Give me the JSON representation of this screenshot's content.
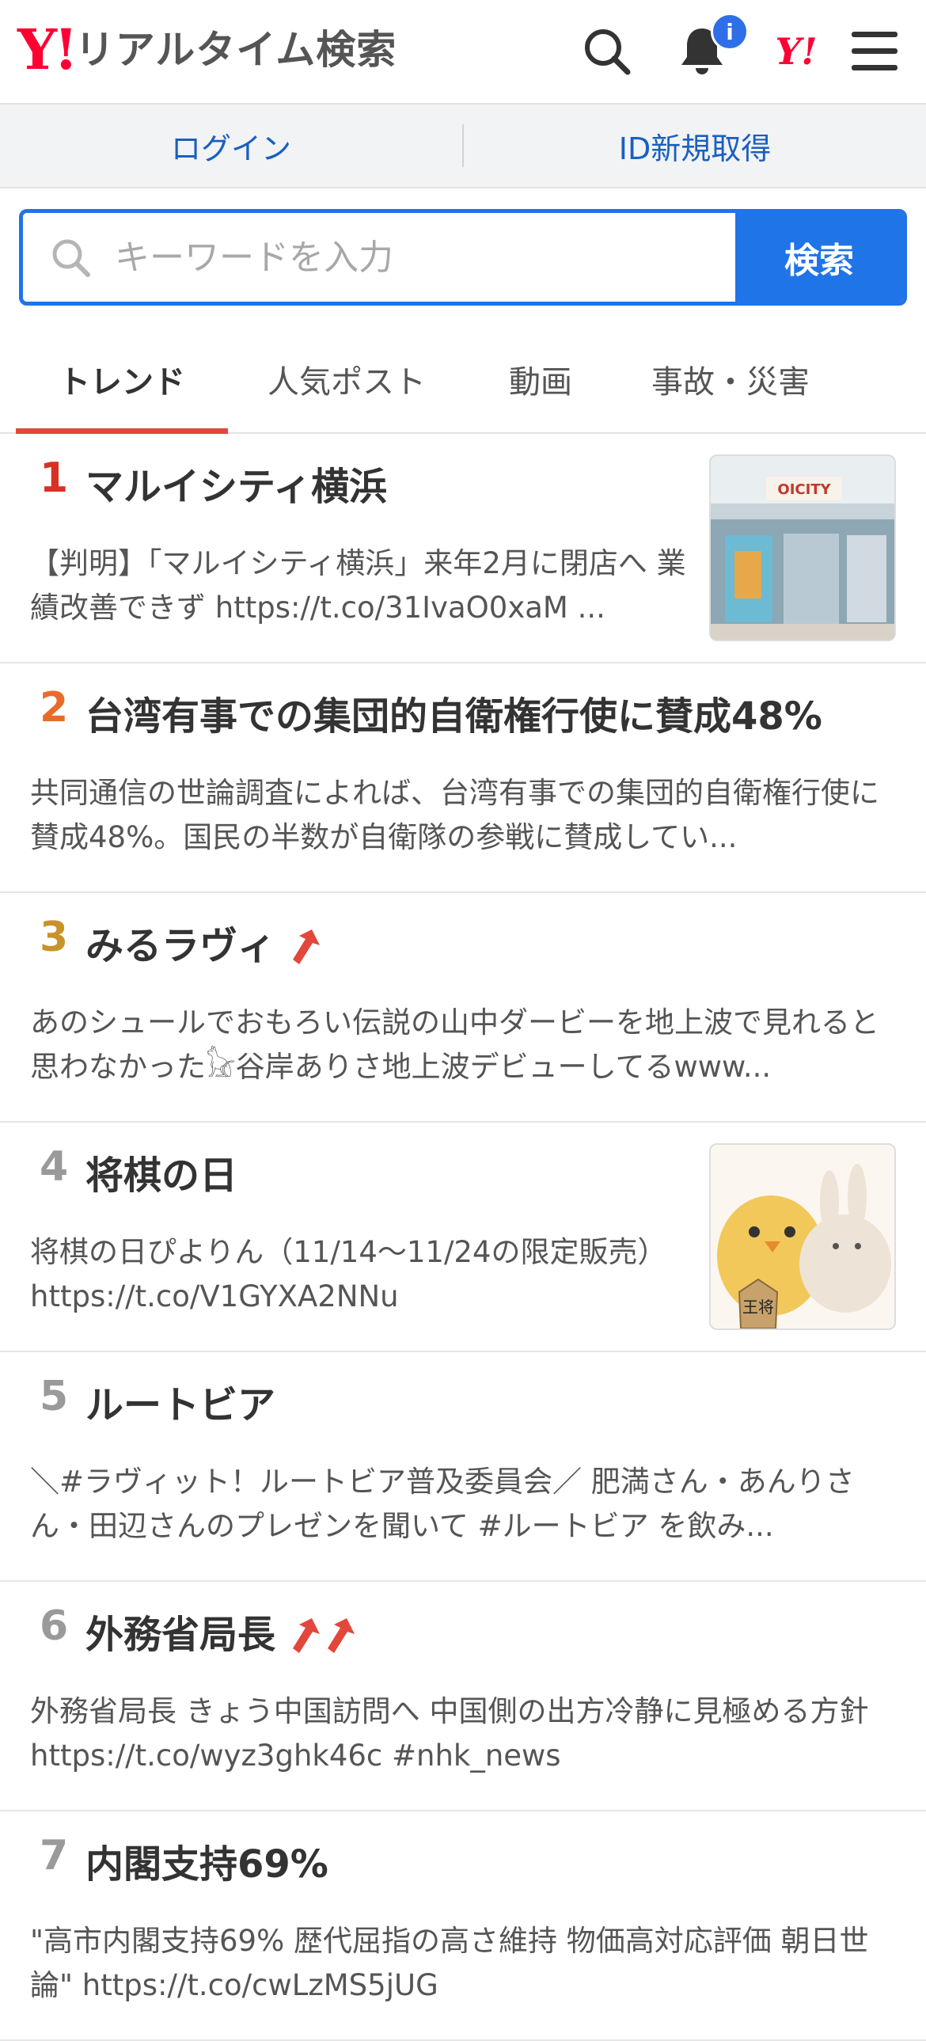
{
  "header": {
    "logo_mark": "Y!",
    "logo_text": "リアルタイム検索",
    "notification_badge": "i",
    "yahoo_short": "Y!"
  },
  "loginbar": {
    "login": "ログイン",
    "signup": "ID新規取得"
  },
  "search": {
    "placeholder": "キーワードを入力",
    "button": "検索"
  },
  "tabs": [
    {
      "label": "トレンド",
      "active": true
    },
    {
      "label": "人気ポスト",
      "active": false
    },
    {
      "label": "動画",
      "active": false
    },
    {
      "label": "事故・災害",
      "active": false
    }
  ],
  "colors": {
    "brand": "#ff0033",
    "accent": "#1f74e8",
    "rank1": "#d93025",
    "rank2": "#ea6a2b",
    "rank3": "#c9932a",
    "rank_other": "#9a9a9a",
    "up_arrow": "#e2473b"
  },
  "trends": [
    {
      "rank": "1",
      "title": "マルイシティ横浜",
      "desc": "【判明】「マルイシティ横浜」来年2月に閉店へ 業績改善できず https://t.co/31IvaO0xaM ...",
      "arrows": 0,
      "thumb": "store-photo",
      "thumb_sign": "OICITY"
    },
    {
      "rank": "2",
      "title": "台湾有事での集団的自衛権行使に賛成48%",
      "desc": "共同通信の世論調査によれば、台湾有事での集団的自衛権行使に賛成48%。国民の半数が自衛隊の参戦に賛成してい...",
      "arrows": 0
    },
    {
      "rank": "3",
      "title": "みるラヴィ",
      "desc": "あのシュールでおもろい伝説の山中ダービーを地上波で見れると思わなかった𓃠谷岸ありさ地上波デビューしてるwww...",
      "arrows": 1
    },
    {
      "rank": "4",
      "title": "将棋の日",
      "desc": "将棋の日ぴよりん（11/14〜11/24の限定販売） https://t.co/V1GYXA2NNu",
      "arrows": 0,
      "thumb": "piyorin-illustration",
      "thumb_sign": "王将"
    },
    {
      "rank": "5",
      "title": "ルートビア",
      "desc": "＼#ラヴィット！ルートビア普及委員会／ 肥満さん・あんりさん・田辺さんのプレゼンを聞いて #ルートビア を飲み...",
      "arrows": 0
    },
    {
      "rank": "6",
      "title": "外務省局長",
      "desc": "外務省局長 きょう中国訪問へ 中国側の出方冷静に見極める方針 https://t.co/wyz3ghk46c #nhk_news",
      "arrows": 2
    },
    {
      "rank": "7",
      "title": "内閣支持69%",
      "desc": "\"高市内閣支持69% 歴代屈指の高さ維持 物価高対応評価 朝日世論\" https://t.co/cwLzMS5jUG",
      "arrows": 0
    }
  ]
}
